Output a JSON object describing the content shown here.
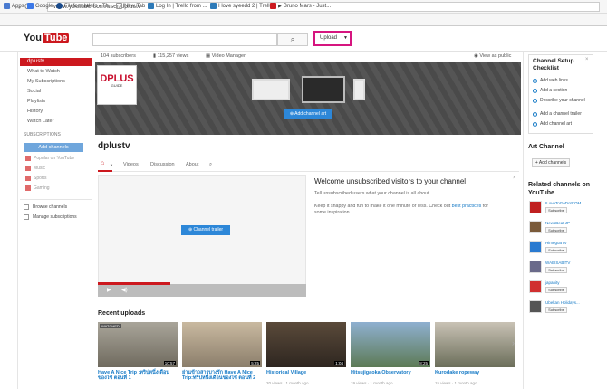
{
  "browser": {
    "nav": "← → C",
    "url": "www.youtube.com/user/dplustv",
    "bookmarks": [
      "Apps",
      "Google",
      "FileformatInfo - Th...",
      "New Tab",
      "Log In | Trello from ...",
      "I love syeedd 2 | Trello",
      "Bruno Mars - Just..."
    ]
  },
  "header": {
    "logo_you": "You",
    "logo_tube": "Tube",
    "search_icon": "search-icon",
    "upload_label": "Upload",
    "upload_caret": "▼",
    "highlight_color": "#d6157f"
  },
  "sidebar": {
    "active": "dplustv",
    "items": [
      "What to Watch",
      "My Subscriptions",
      "Social",
      "Playlists",
      "History",
      "Watch Later"
    ],
    "subscriptions_label": "SUBSCRIPTIONS",
    "add_channels": "Add channels",
    "sub_items": [
      "Popular on YouTube",
      "Music",
      "Sports",
      "Gaming"
    ],
    "browse": "Browse channels",
    "manage": "Manage subscriptions"
  },
  "stats": {
    "subscribers": "104 subscribers",
    "views": "115,257 views",
    "video_manager": "Video Manager",
    "view_as_public": "View as public"
  },
  "banner": {
    "logo_d": "DPLUS",
    "logo_guide": "GUIDE",
    "add_channel_art": "Add channel art"
  },
  "channel": {
    "name": "dplustv",
    "tabs": [
      "Videos",
      "Discussion",
      "About"
    ]
  },
  "trailer": {
    "button": "Channel trailer",
    "welcome_title": "Welcome unsubscribed visitors to your channel",
    "line1": "Tell unsubscribed users what your channel is all about.",
    "line2a": "Keep it snappy and fun to make it one minute or less. Check out ",
    "line2_link": "best practices",
    "line2b": " for",
    "line3": "some inspiration."
  },
  "recent": {
    "title": "Recent uploads",
    "videos": [
      {
        "title1": "Have A Nice Trip :ทริปหนึ่งเดือน",
        "title2": "ของไซ่ ตอนที่ 1",
        "meta": "",
        "duration": "10:57",
        "badge": "WATCHED",
        "color1": "#a9a59a",
        "color2": "#6f6a5e"
      },
      {
        "title1": "ย่านข้าวสารบางรัก Have A Nice",
        "title2": "Trip:ทริปหนึ่งเดือนของไซ่ ตอนที่ 2",
        "meta": "",
        "duration": "5:25",
        "badge": "",
        "color1": "#c9b9a0",
        "color2": "#8b7e6b"
      },
      {
        "title1": "Historical Village",
        "title2": "",
        "meta": "20 views · 1 month ago",
        "duration": "1:04",
        "badge": "",
        "color1": "#5a4a3a",
        "color2": "#2e2620"
      },
      {
        "title1": "Hitsujigaoka Observatory",
        "title2": "",
        "meta": "19 views · 1 month ago",
        "duration": "8:25",
        "badge": "",
        "color1": "#8fb0d0",
        "color2": "#5d7a55"
      },
      {
        "title1": "Kurodake ropeway",
        "title2": "",
        "meta": "15 views · 1 month ago",
        "duration": "",
        "badge": "",
        "color1": "#c9c2b5",
        "color2": "#6b6e5a"
      }
    ]
  },
  "checklist": {
    "title": "Channel Setup Checklist",
    "items": [
      "Add web links",
      "Add a section",
      "Describe your channel",
      "Add a channel trailer",
      "Add channel art"
    ]
  },
  "art_channel": {
    "title": "Art Channel",
    "button": "+ Add channels"
  },
  "related": {
    "title": "Related channels on YouTube",
    "subscribe": "Subscribe",
    "channels": [
      {
        "name": "ILoveToGoDotCOM",
        "color": "#c02020"
      },
      {
        "name": "NewsBeat JP",
        "color": "#7a5a3a"
      },
      {
        "name": "HimegoaTV",
        "color": "#2a7ad0"
      },
      {
        "name": "WABISABITV",
        "color": "#6a6a8a"
      },
      {
        "name": "japanity",
        "color": "#d03030"
      },
      {
        "name": "Ubekan Holidays...",
        "color": "#555555"
      }
    ]
  }
}
